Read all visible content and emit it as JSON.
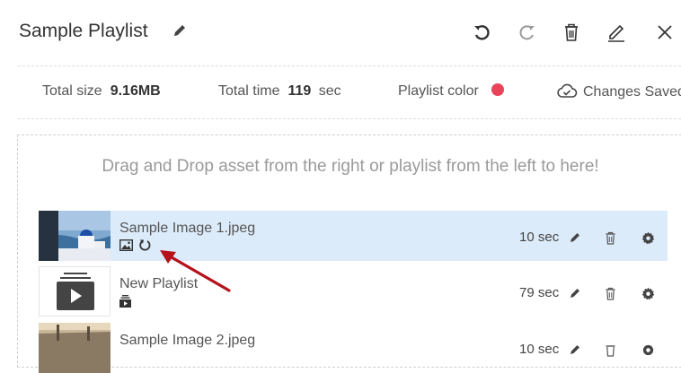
{
  "header": {
    "title": "Sample Playlist",
    "actions": [
      "undo-icon",
      "redo-icon",
      "trash-icon",
      "edit-icon",
      "close-icon"
    ]
  },
  "info": {
    "size_label": "Total size",
    "size_value": "9.16MB",
    "time_label": "Total time",
    "time_value": "119",
    "time_unit": "sec",
    "color_label": "Playlist color",
    "color_value": "#e8455a",
    "save_status": "Changes Saved"
  },
  "dropzone": {
    "text": "Drag and Drop asset from the right or playlist from the left to here!"
  },
  "items": [
    {
      "name": "Sample Image 1.jpeg",
      "duration": "10 sec",
      "type": "image",
      "selected": true
    },
    {
      "name": "New Playlist",
      "duration": "79 sec",
      "type": "playlist",
      "selected": false
    },
    {
      "name": "Sample Image 2.jpeg",
      "duration": "10 sec",
      "type": "image",
      "selected": false
    }
  ],
  "colors": {
    "selected_row": "#dcebfa",
    "arrow": "#b5121b",
    "playlist_dot": "#e8455a"
  }
}
